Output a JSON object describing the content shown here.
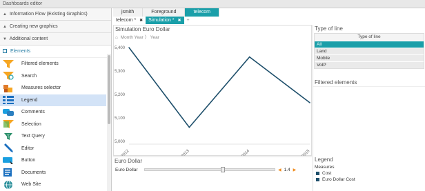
{
  "window": {
    "title": "Dashboards editor"
  },
  "left_panel": {
    "accordions": [
      {
        "label": "Information Flow (Existing Graphics)"
      },
      {
        "label": "Creating new graphics"
      },
      {
        "label": "Additional content"
      }
    ],
    "elements_header": "Elements",
    "elements": [
      {
        "label": "Filtered elements",
        "icon": "funnel-icon"
      },
      {
        "label": "Search",
        "icon": "search-funnel-icon"
      },
      {
        "label": "Measures selector",
        "icon": "cubes-icon"
      },
      {
        "label": "Legend",
        "icon": "legend-icon",
        "selected": true
      },
      {
        "label": "Comments",
        "icon": "comments-icon"
      },
      {
        "label": "Selection",
        "icon": "selection-icon"
      },
      {
        "label": "Text Query",
        "icon": "text-query-icon"
      },
      {
        "label": "Editor",
        "icon": "pencil-icon"
      },
      {
        "label": "Button",
        "icon": "button-icon"
      },
      {
        "label": "Documents",
        "icon": "documents-icon"
      },
      {
        "label": "Web Site",
        "icon": "globe-icon"
      }
    ]
  },
  "tabs_top": [
    {
      "label": "jsmith",
      "active": false
    },
    {
      "label": "Foreground",
      "active": false
    },
    {
      "label": "telecom",
      "active": true
    }
  ],
  "tabs_doc": [
    {
      "label": "telecom *",
      "active": false
    },
    {
      "label": "Simulation *",
      "active": true
    }
  ],
  "chart_panel": {
    "title": "Simulation Euro Dollar",
    "breadcrumb": [
      "Month Year",
      "Year"
    ]
  },
  "chart_data": {
    "type": "line",
    "x": [
      "2012",
      "2013",
      "2014",
      "2015"
    ],
    "series": [
      {
        "values": [
          5400,
          5060,
          5360,
          5165
        ]
      }
    ],
    "ylim": [
      5000,
      5400
    ],
    "yticks": [
      "5,000",
      "5,100",
      "5,200",
      "5,300",
      "5,400"
    ],
    "color": "#1e4f6b",
    "grid": false
  },
  "euro_dollar": {
    "title": "Euro Dollar",
    "label": "Euro Dollar",
    "value": "1.4",
    "position": 0.6
  },
  "type_of_line": {
    "title": "Type of line",
    "header": "Type of line",
    "items": [
      {
        "label": "All",
        "selected": true
      },
      {
        "label": "Land"
      },
      {
        "label": "Mobile"
      },
      {
        "label": "VoIP"
      }
    ]
  },
  "filtered_elements": {
    "title": "Filtered elements"
  },
  "legend": {
    "title": "Legend",
    "subtitle": "Measures",
    "items": [
      {
        "label": "Cost"
      },
      {
        "label": "Euro Dollar Cost"
      }
    ]
  },
  "colors": {
    "accent": "#1a9fa9",
    "line": "#1e4f6b",
    "selected_row": "#d3e3f7"
  }
}
